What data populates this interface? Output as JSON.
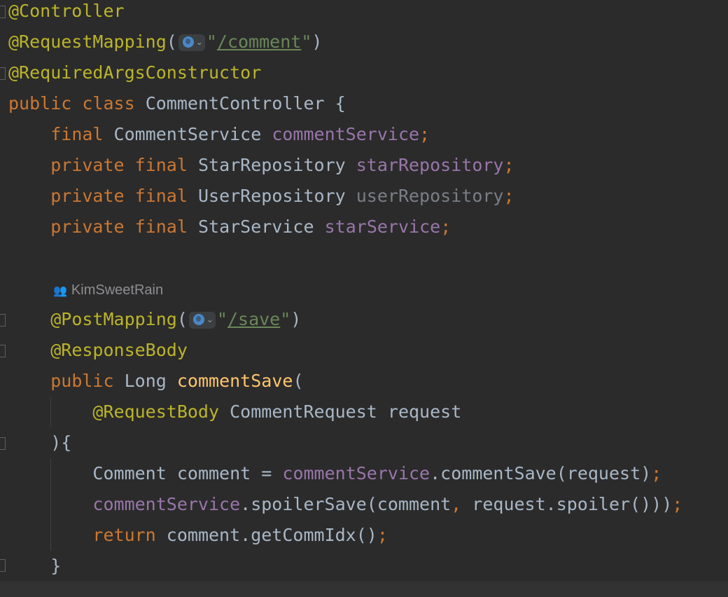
{
  "editor": {
    "lines": {
      "l1": "@Controller",
      "l2_ann": "@RequestMapping",
      "l2_path": "/comment",
      "l3": "@RequiredArgsConstructor",
      "l4_kw1": "public",
      "l4_kw2": "class",
      "l4_name": "CommentController",
      "l4_brace": "{",
      "l5_kw": "final",
      "l5_type": "CommentService",
      "l5_field": "commentService",
      "l6_kw1": "private",
      "l6_kw2": "final",
      "l6_type": "StarRepository",
      "l6_field": "starRepository",
      "l7_kw1": "private",
      "l7_kw2": "final",
      "l7_type": "UserRepository",
      "l7_field": "userRepository",
      "l8_kw1": "private",
      "l8_kw2": "final",
      "l8_type": "StarService",
      "l8_field": "starService",
      "author": "KimSweetRain",
      "l9_ann": "@PostMapping",
      "l9_path": "/save",
      "l10": "@ResponseBody",
      "l11_kw": "public",
      "l11_type": "Long",
      "l11_method": "commentSave",
      "l12_ann": "@RequestBody",
      "l12_type": "CommentRequest",
      "l12_param": "request",
      "l13": "){",
      "l14_type": "Comment",
      "l14_var": "comment",
      "l14_field": "commentService",
      "l14_rest": ".commentSave(request)",
      "l15_field": "commentService",
      "l15_rest": ".spoilerSave(comment",
      "l15_rest2": " request.spoiler())",
      "l16_kw": "return",
      "l16_rest": "comment.getCommIdx()",
      "l17": "}"
    }
  },
  "icons": {
    "globe": "globe-icon",
    "author": "people-icon"
  },
  "colors": {
    "background": "#2b2b2b",
    "annotation": "#bbb529",
    "keyword": "#cc7832",
    "field": "#9876aa",
    "string": "#6a8759",
    "method": "#ffc66d",
    "text": "#a9b7c6"
  }
}
